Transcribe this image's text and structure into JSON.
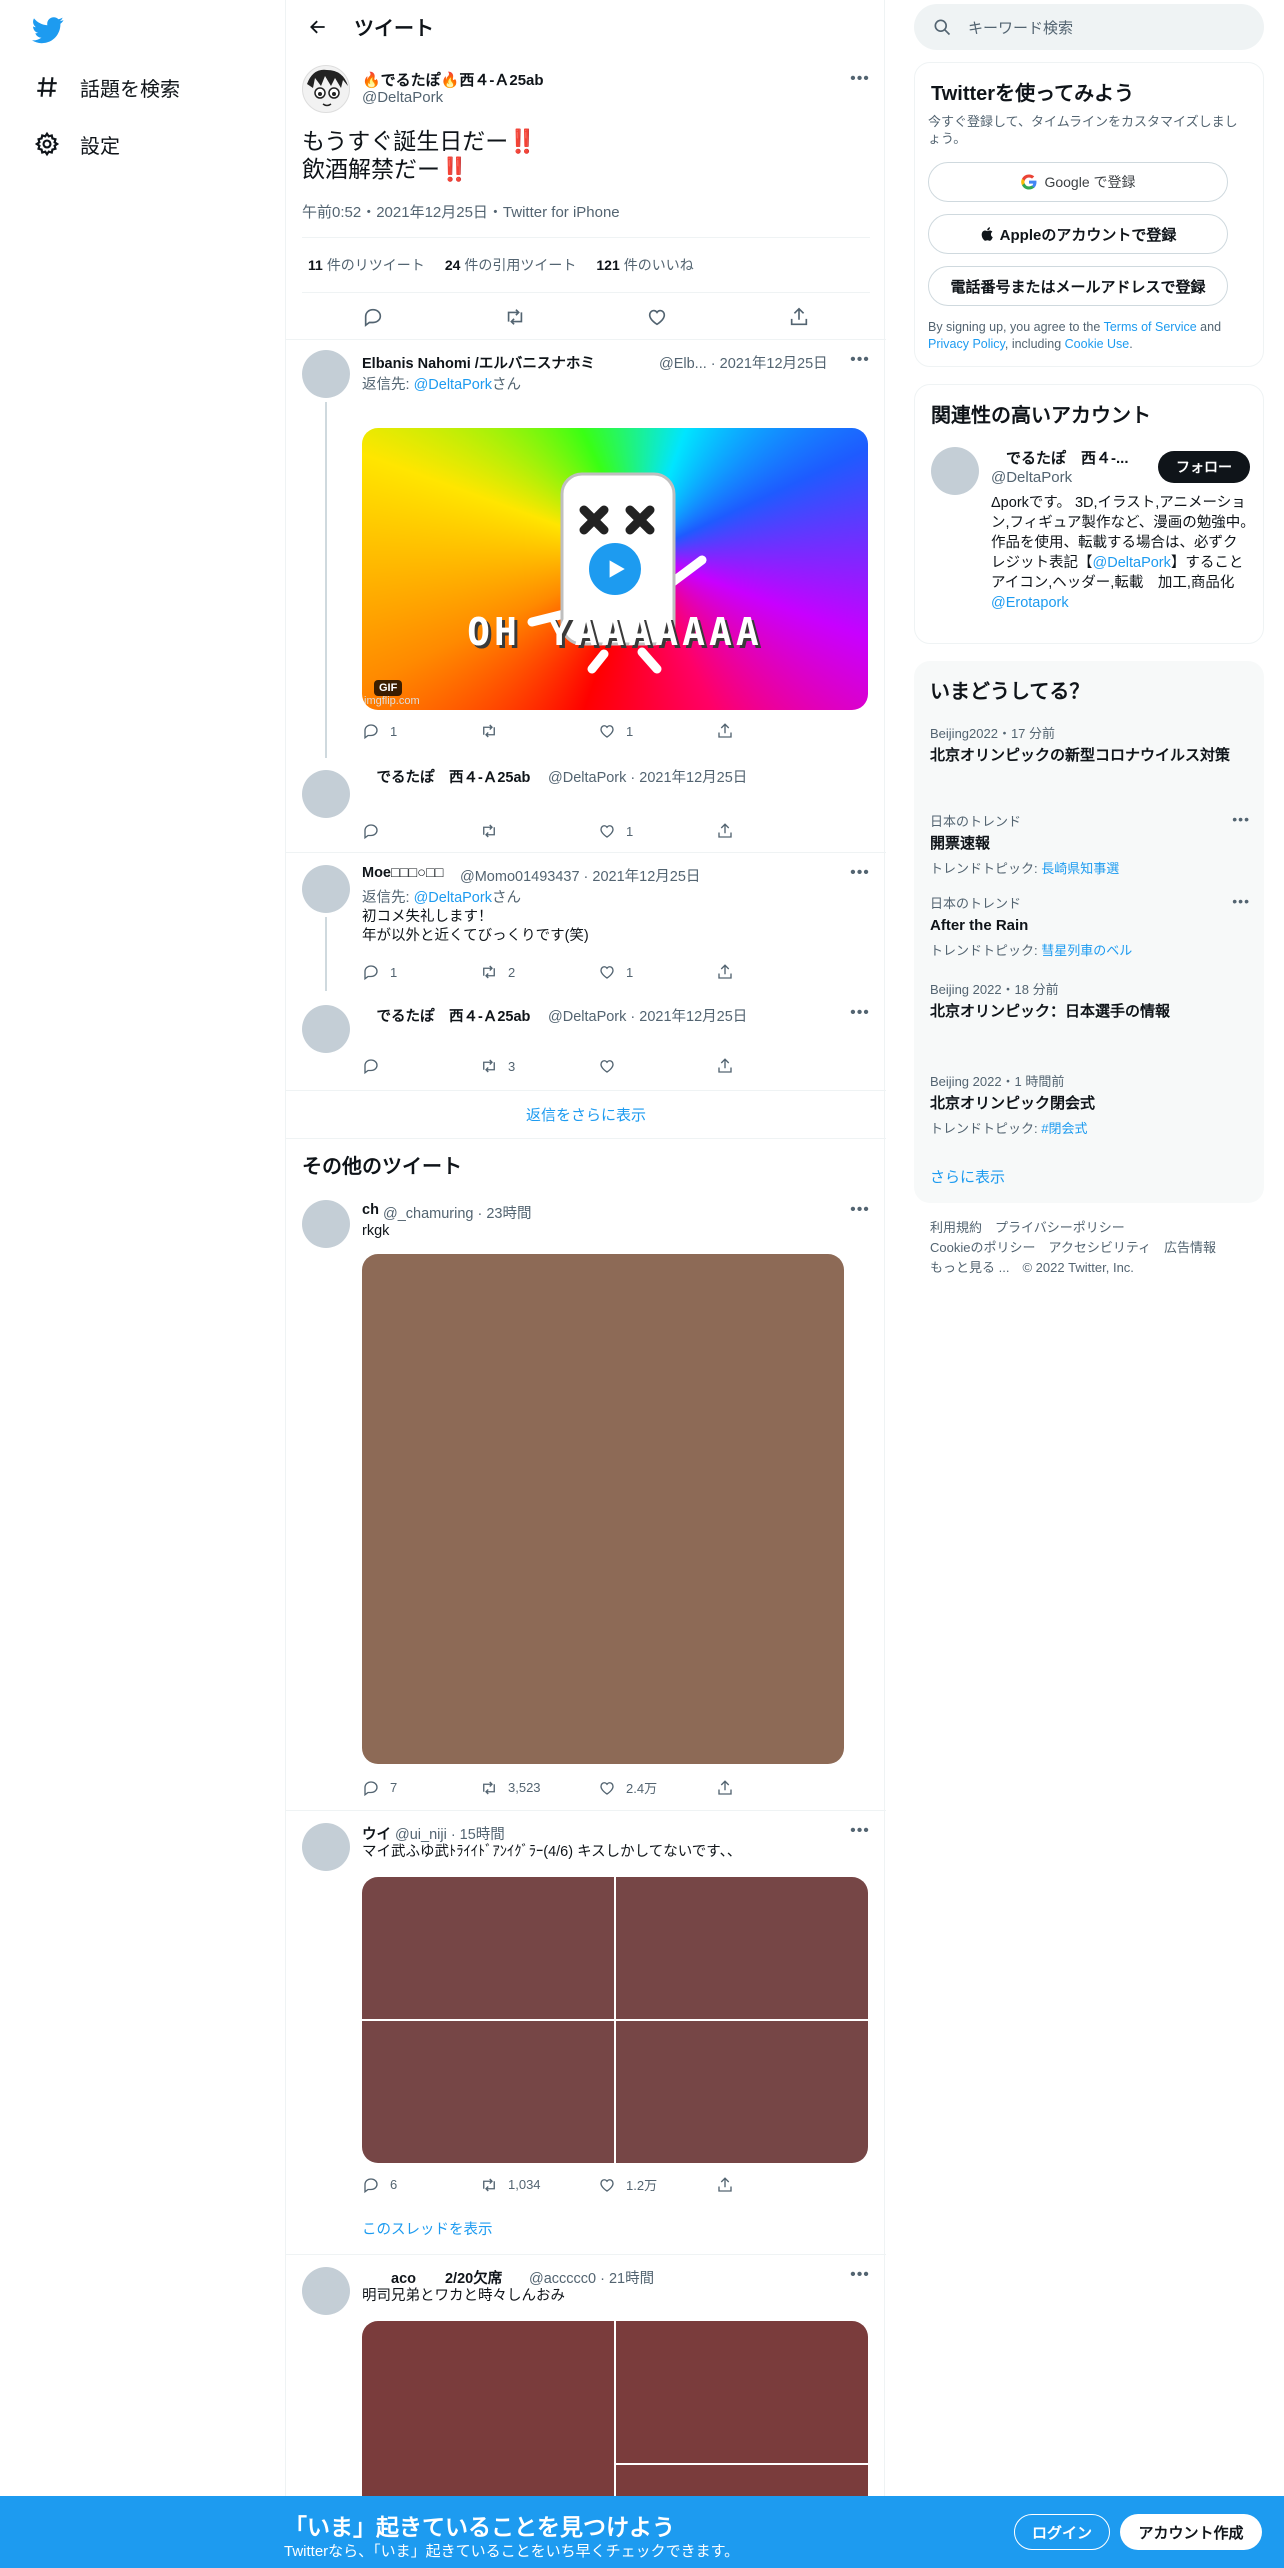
{
  "nav": {
    "items": [
      {
        "label": "話題を検索",
        "icon": "hashtag-icon"
      },
      {
        "label": "設定",
        "icon": "gear-icon"
      }
    ]
  },
  "header": {
    "title": "ツイート"
  },
  "main_tweet": {
    "name": "🔥でるたぽ🔥西４-Ａ25ab",
    "handle": "@DeltaPork",
    "text_line1": "もうすぐ誕生日だー‼️",
    "text_line2": "飲酒解禁だー‼️",
    "meta": "午前0:52・2021年12月25日・Twitter for iPhone",
    "retweets_count": "11",
    "retweets_label": "件のリツイート",
    "quotes_count": "24",
    "quotes_label": "件の引用ツイート",
    "likes_count": "121",
    "likes_label": "件のいいね"
  },
  "replies": [
    {
      "name": "Elbanis Nahomi /エルバニスナホミ",
      "meta": "@Elb... · 2021年12月25日",
      "reply_prefix": "返信先: ",
      "reply_to": "@DeltaPork",
      "reply_suffix": "さん",
      "gif_caption": "OH YAAAAAAA",
      "gif_badge": "GIF",
      "gif_watermark": "imgflip.com",
      "reply_count": "1",
      "retweet_count": "",
      "like_count": "1"
    },
    {
      "name": "　でるたぽ　西４-Ａ25ab",
      "meta": "@DeltaPork · 2021年12月25日",
      "reply_count": "",
      "retweet_count": "",
      "like_count": "1"
    },
    {
      "name": "Moe□□□○□□",
      "meta": "@Momo01493437 · 2021年12月25日",
      "reply_prefix": "返信先: ",
      "reply_to": "@DeltaPork",
      "reply_suffix": "さん",
      "text_line1": "初コメ失礼します！",
      "text_line2": "年が以外と近くてびっくりです(笑)",
      "reply_count": "1",
      "retweet_count": "2",
      "like_count": "1"
    },
    {
      "name": "　でるたぽ　西４-Ａ25ab",
      "meta": "@DeltaPork · 2021年12月25日",
      "reply_count": "",
      "retweet_count": "3",
      "like_count": ""
    }
  ],
  "show_more_replies": "返信をさらに表示",
  "other_tweets_title": "その他のツイート",
  "other_tweets": [
    {
      "name": "ch",
      "meta": "@_chamuring · 23時間",
      "text": "rkgk",
      "media_color": "#8d6a56",
      "reply_count": "7",
      "retweet_count": "3,523",
      "like_count": "2.4万"
    },
    {
      "name": "ウイ",
      "meta": "@ui_niji · 15時間",
      "text": "マイ武ふゆ武ﾄﾗｲｲﾄﾞｱﾝｲｸﾞﾗｰ(4/6) キスしかしてないです、、",
      "media_color": "#764646",
      "reply_count": "6",
      "retweet_count": "1,034",
      "like_count": "1.2万",
      "thread_link": "このスレッドを表示"
    },
    {
      "name": "　　aco　　2/20欠席",
      "meta": "@accccc0 · 21時間",
      "text": "明司兄弟とワカと時々しんおみ",
      "media_color": "#7a3c3c"
    }
  ],
  "right": {
    "search_placeholder": "キーワード検索",
    "signup": {
      "title": "Twitterを使ってみよう",
      "subtitle": "今すぐ登録して、タイムラインをカスタマイズしましょう。",
      "google_label": "Google で登録",
      "apple_label": "Appleのアカウントで登録",
      "phone_label": "電話番号またはメールアドレスで登録",
      "terms_prefix": "By signing up, you agree to the ",
      "terms_link": "Terms of Service",
      "terms_and": " and ",
      "privacy_link": "Privacy Policy",
      "terms_including": ", including ",
      "cookie_link": "Cookie Use",
      "terms_end": "."
    },
    "related": {
      "title": "関連性の高いアカウント",
      "name": "　でるたぽ　西４-...",
      "handle": "@DeltaPork",
      "follow_label": "フォロー",
      "bio_part1": "Δporkです。 3D,イラスト,アニメーション,フィギュア製作など、漫画の勉強中。　作品を使用、転載する場合は、必ずクレジット表記【",
      "bio_link1": "@DeltaPork",
      "bio_part2": "】すること　　アイコン,ヘッダー,転載　加工,商品化",
      "bio_link2": "@Erotapork"
    },
    "trends": {
      "title": "いまどうしてる？",
      "items": [
        {
          "meta": "Beijing2022・17 分前",
          "title": "北京オリンピックの新型コロナウイルス対策",
          "topic_label": "",
          "topic_link": ""
        },
        {
          "meta": "日本のトレンド",
          "title": "開票速報",
          "topic_label": "トレンドトピック: ",
          "topic_link": "長崎県知事選"
        },
        {
          "meta": "日本のトレンド",
          "title": "After the Rain",
          "topic_label": "トレンドトピック: ",
          "topic_link": "彗星列車のベル"
        },
        {
          "meta": "Beijing 2022・18 分前",
          "title": "北京オリンピック：日本選手の情報",
          "topic_label": "",
          "topic_link": ""
        },
        {
          "meta": "Beijing 2022・1 時間前",
          "title": "北京オリンピック閉会式",
          "topic_label": "トレンドトピック: ",
          "topic_link": "#閉会式"
        }
      ],
      "show_more": "さらに表示"
    },
    "footer": {
      "line1": "利用規約　プライバシーポリシー",
      "line2": "Cookieのポリシー　アクセシビリティ　広告情報",
      "line3": "もっと見る ...　© 2022 Twitter, Inc."
    }
  },
  "bottom_bar": {
    "title": "「いま」起きていることを見つけよう",
    "subtitle": "Twitterなら、「いま」起きていることをいち早くチェックできます。",
    "login_label": "ログイン",
    "signup_label": "アカウント作成"
  },
  "colors": {
    "accent": "#1d9bf0",
    "text": "#0f1419",
    "muted": "#536471"
  }
}
